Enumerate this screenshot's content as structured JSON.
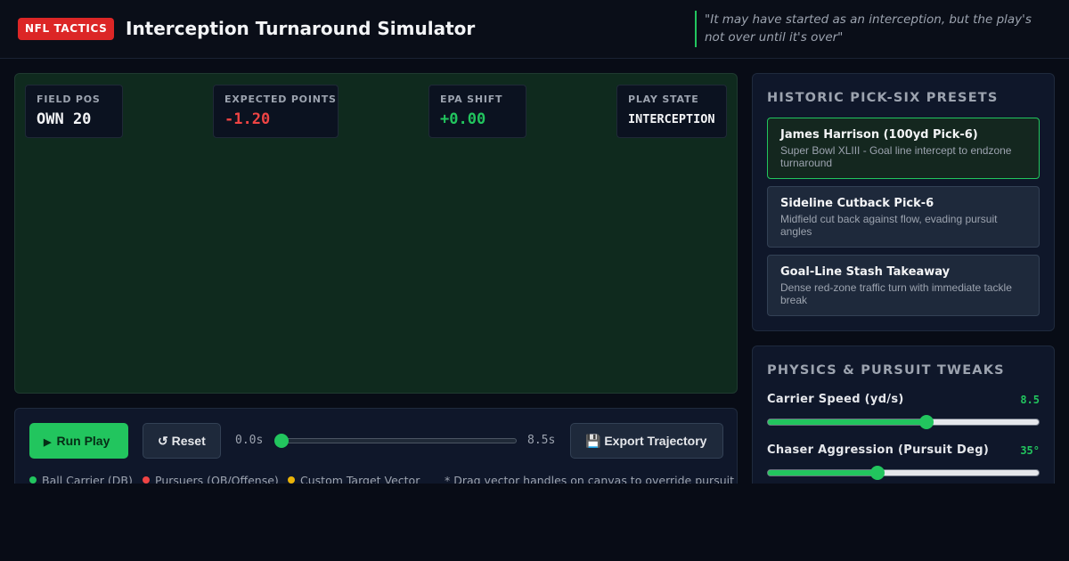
{
  "header": {
    "badge": "NFL TACTICS",
    "title": "Interception Turnaround Simulator",
    "quote": "\"It may have started as an interception, but the play's not over until it's over\""
  },
  "stats": {
    "field_pos": {
      "label": "FIELD POS",
      "value": "OWN 20"
    },
    "expected_points": {
      "label": "EXPECTED POINTS",
      "value": "-1.20"
    },
    "epa_shift": {
      "label": "EPA SHIFT",
      "value": "+0.00"
    },
    "play_state": {
      "label": "PLAY STATE",
      "value": "INTERCEPTION"
    }
  },
  "controls": {
    "run_label": "Run Play",
    "run_icon": "play-icon",
    "reset_label": "↺ Reset",
    "time_start": "0.0s",
    "time_end": "8.5s",
    "timeline_progress": 0,
    "export_label": "💾 Export Trajectory"
  },
  "legend": {
    "carrier": "Ball Carrier (DB)",
    "pursuers": "Pursuers (QB/Offense)",
    "target": "Custom Target Vector",
    "hint": "* Drag vector handles on canvas to override pursuit"
  },
  "presets": {
    "title": "HISTORIC PICK-SIX PRESETS",
    "items": [
      {
        "name": "James Harrison (100yd Pick-6)",
        "desc": "Super Bowl XLIII - Goal line intercept to endzone turnaround",
        "active": true
      },
      {
        "name": "Sideline Cutback Pick-6",
        "desc": "Midfield cut back against flow, evading pursuit angles",
        "active": false
      },
      {
        "name": "Goal-Line Stash Takeaway",
        "desc": "Dense red-zone traffic turn with immediate tackle break",
        "active": false
      }
    ]
  },
  "physics": {
    "title": "PHYSICS & PURSUIT TWEAKS",
    "carrier_speed": {
      "label": "Carrier Speed (yd/s)",
      "value": "8.5",
      "fraction": 0.59
    },
    "chaser_aggression": {
      "label": "Chaser Aggression (Pursuit Deg)",
      "value": "35°",
      "fraction": 0.4
    }
  },
  "colors": {
    "accent": "#22c55e",
    "danger": "#ef4444",
    "warning": "#eab308",
    "field": "#0f2a1e",
    "panel": "#0f172a"
  }
}
